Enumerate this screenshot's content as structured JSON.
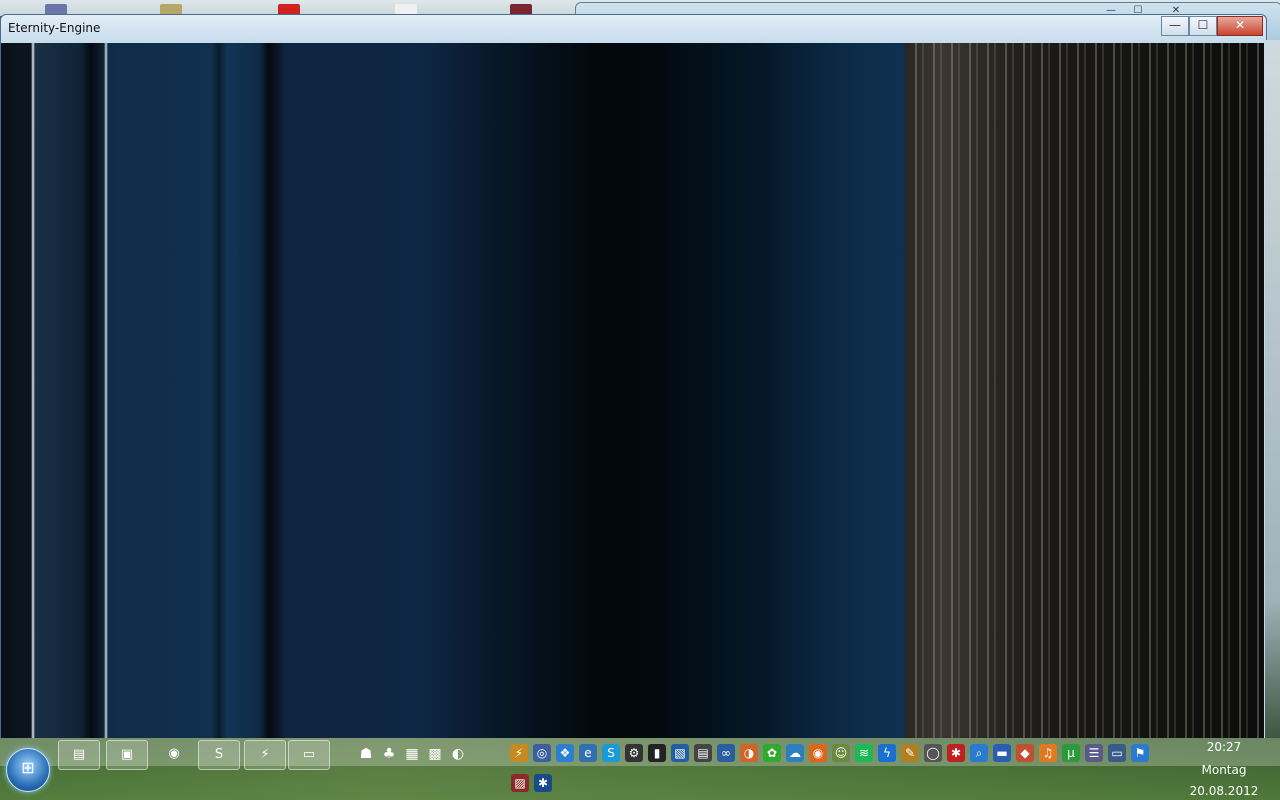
{
  "window": {
    "title": "Eternity-Engine",
    "minimize_symbol": "—",
    "maximize_symbol": "☐",
    "close_symbol": "✕"
  },
  "background_window": {
    "minimize_symbol": "—",
    "maximize_symbol": "☐",
    "close_symbol": "✕"
  },
  "taskbar": {
    "start_symbol": "⊞",
    "pinned": [
      {
        "name": "explorer-icon",
        "glyph": "▤"
      },
      {
        "name": "windows-explorer-icon",
        "glyph": "▣"
      },
      {
        "name": "firefox-icon",
        "glyph": "◉"
      },
      {
        "name": "skype-icon",
        "glyph": "S"
      },
      {
        "name": "winamp-icon",
        "glyph": "⚡"
      },
      {
        "name": "window-icon",
        "glyph": "▭"
      }
    ],
    "quicklaunch": [
      {
        "name": "helmet-icon",
        "glyph": "☗"
      },
      {
        "name": "dragon-icon",
        "glyph": "♣"
      },
      {
        "name": "app-window-icon",
        "glyph": "▦"
      },
      {
        "name": "cube-icon",
        "glyph": "▩"
      },
      {
        "name": "eternity-icon",
        "glyph": "◐"
      }
    ],
    "tray": [
      {
        "name": "winamp-tray-icon",
        "glyph": "⚡"
      },
      {
        "name": "cd-icon",
        "glyph": "◎"
      },
      {
        "name": "dropbox-icon",
        "glyph": "❖"
      },
      {
        "name": "e-icon",
        "glyph": "e"
      },
      {
        "name": "skype-tray-icon",
        "glyph": "S"
      },
      {
        "name": "steam-icon",
        "glyph": "⚙"
      },
      {
        "name": "terminal-icon",
        "glyph": "▮"
      },
      {
        "name": "image-icon",
        "glyph": "▧"
      },
      {
        "name": "gps-icon",
        "glyph": "▤"
      },
      {
        "name": "link-icon",
        "glyph": "∞"
      },
      {
        "name": "browser-icon",
        "glyph": "◑"
      },
      {
        "name": "icq-icon",
        "glyph": "✿"
      },
      {
        "name": "network-icon",
        "glyph": "☁"
      },
      {
        "name": "firefox-tray-icon",
        "glyph": "◉"
      },
      {
        "name": "portrait-icon",
        "glyph": "☺"
      },
      {
        "name": "spotify-icon",
        "glyph": "≋"
      },
      {
        "name": "lightning-icon",
        "glyph": "ϟ"
      },
      {
        "name": "tool-icon",
        "glyph": "✎"
      },
      {
        "name": "circle-icon",
        "glyph": "◯"
      },
      {
        "name": "splash-icon",
        "glyph": "✱"
      },
      {
        "name": "magnifier-icon",
        "glyph": "⌕"
      },
      {
        "name": "blue-bar-icon",
        "glyph": "▬"
      },
      {
        "name": "diamond-icon",
        "glyph": "◆"
      },
      {
        "name": "music-icon",
        "glyph": "♫"
      },
      {
        "name": "utorrent-icon",
        "glyph": "µ"
      },
      {
        "name": "chat-icon",
        "glyph": "☰"
      },
      {
        "name": "monitor-icon",
        "glyph": "▭"
      },
      {
        "name": "wifi-icon",
        "glyph": "⚑"
      }
    ],
    "tray_row2": [
      {
        "name": "striped-icon",
        "glyph": "▨"
      },
      {
        "name": "bluetooth-icon",
        "glyph": "✱"
      }
    ],
    "show_hidden_symbol": "▲",
    "clock": {
      "time": "20:27",
      "day": "Montag",
      "date": "20.08.2012"
    }
  },
  "colors": {
    "accent": "#2a6fb7",
    "close": "#c7452f"
  }
}
